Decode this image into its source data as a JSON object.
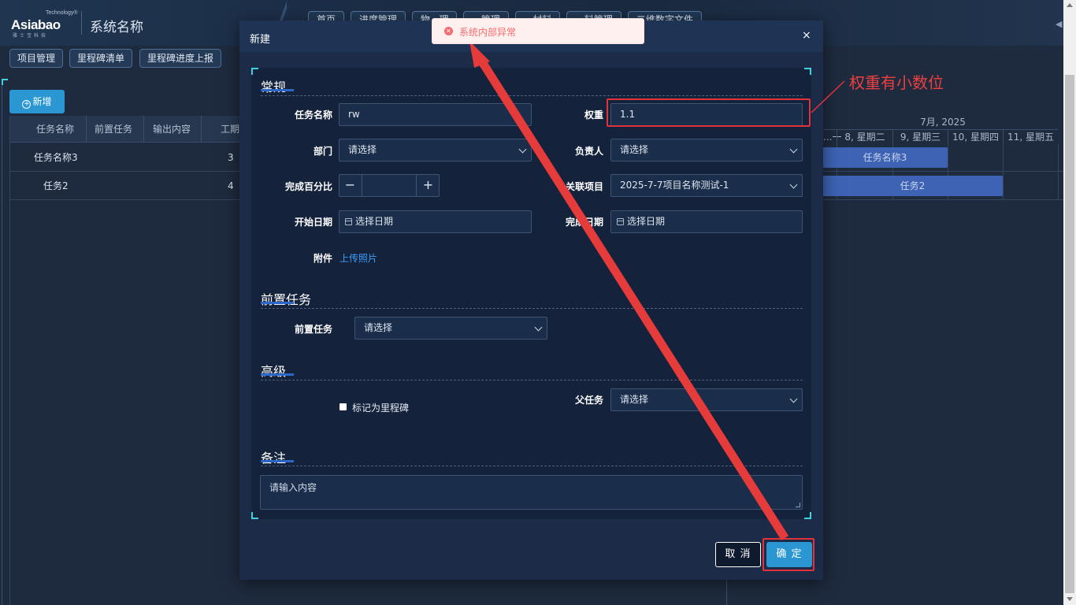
{
  "header": {
    "logo_main": "Asiabao",
    "logo_tech": "Technology®",
    "logo_sub": "雅士宝科技",
    "system_name": "系统名称",
    "nav_items": [
      "首页",
      "进度管理",
      "物...理",
      "...管理",
      "...材料",
      "...料管理",
      "二维数字文件"
    ]
  },
  "subnav": {
    "items": [
      "项目管理",
      "里程碑清单",
      "里程碑进度上报"
    ]
  },
  "main": {
    "add_button": "新增",
    "table": {
      "columns": [
        "任务名称",
        "前置任务",
        "输出内容",
        "工期"
      ],
      "rows": [
        {
          "name": "任务名称3",
          "duration": "3"
        },
        {
          "name": "任务2",
          "duration": "4"
        }
      ]
    },
    "gantt": {
      "month": "7月, 2025",
      "days": [
        "...一",
        "8, 星期二",
        "9, 星期三",
        "10, 星期四",
        "11, 星期五"
      ],
      "bars": [
        {
          "label": "任务名称3"
        },
        {
          "label": "任务2"
        }
      ]
    }
  },
  "modal": {
    "title": "新建",
    "close_icon": "×",
    "sections": {
      "general": "常规",
      "predecessor": "前置任务",
      "advanced": "高级",
      "remarks": "备注"
    },
    "fields": {
      "task_name": {
        "label": "任务名称",
        "value": "rw"
      },
      "weight": {
        "label": "权重",
        "value": "1.1"
      },
      "department": {
        "label": "部门",
        "placeholder": "请选择"
      },
      "owner": {
        "label": "负责人",
        "placeholder": "请选择"
      },
      "percent": {
        "label": "完成百分比",
        "minus": "−",
        "plus": "+"
      },
      "project": {
        "label": "关联项目",
        "value": "2025-7-7项目名称测试-1"
      },
      "start_date": {
        "label": "开始日期",
        "placeholder": "选择日期"
      },
      "end_date": {
        "label": "完成日期",
        "placeholder": "选择日期"
      },
      "attachment": {
        "label": "附件",
        "link": "上传照片"
      },
      "predecessor": {
        "label": "前置任务",
        "placeholder": "请选择"
      },
      "milestone": {
        "label": "标记为里程碑"
      },
      "parent": {
        "label": "父任务",
        "placeholder": "请选择"
      },
      "remarks": {
        "placeholder": "请输入内容"
      }
    },
    "buttons": {
      "cancel": "取 消",
      "ok": "确 定"
    }
  },
  "toast": {
    "message": "系统内部异常"
  },
  "annotation": {
    "text": "权重有小数位"
  },
  "colors": {
    "accent": "#2b97d2",
    "highlight": "#e2323a",
    "error": "#f56c6c"
  }
}
